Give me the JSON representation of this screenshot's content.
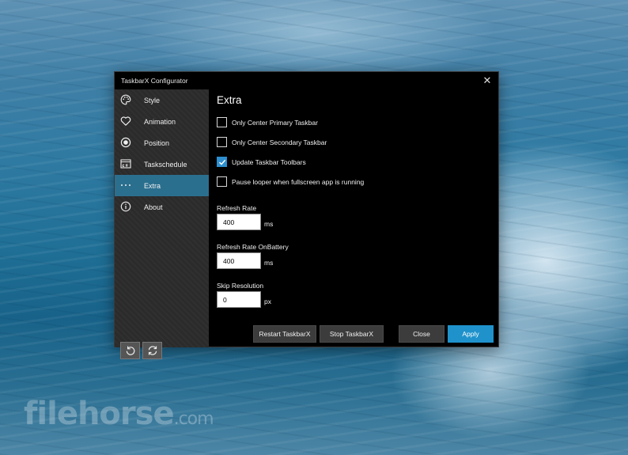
{
  "window": {
    "title": "TaskbarX Configurator",
    "close_glyph": "✕"
  },
  "sidebar": {
    "items": [
      {
        "label": "Style",
        "icon": "palette-icon",
        "active": false
      },
      {
        "label": "Animation",
        "icon": "heart-icon",
        "active": false
      },
      {
        "label": "Position",
        "icon": "radio-target-icon",
        "active": false
      },
      {
        "label": "Taskschedule",
        "icon": "calendar-icon",
        "active": false
      },
      {
        "label": "Extra",
        "icon": "more-dots-icon",
        "active": true
      },
      {
        "label": "About",
        "icon": "info-icon",
        "active": false
      }
    ],
    "bottom_buttons": [
      {
        "icon": "undo-icon"
      },
      {
        "icon": "refresh-icon"
      }
    ],
    "active_color": "#2b6f8f"
  },
  "content": {
    "heading": "Extra",
    "checkboxes": [
      {
        "label": "Only Center Primary Taskbar",
        "checked": false
      },
      {
        "label": "Only Center Secondary Taskbar",
        "checked": false
      },
      {
        "label": "Update Taskbar Toolbars",
        "checked": true
      },
      {
        "label": "Pause looper when fullscreen app is running",
        "checked": false
      }
    ],
    "fields": [
      {
        "label": "Refresh Rate",
        "value": "400",
        "unit": "ms"
      },
      {
        "label": "Refresh Rate OnBattery",
        "value": "400",
        "unit": "ms"
      },
      {
        "label": "Skip Resolution",
        "value": "0",
        "unit": "px"
      }
    ],
    "buttons": {
      "restart": "Restart TaskbarX",
      "stop": "Stop TaskbarX",
      "close": "Close",
      "apply": "Apply"
    },
    "accent_color": "#1f92cc"
  },
  "watermark": {
    "text": "filehorse",
    "suffix": ".com"
  }
}
